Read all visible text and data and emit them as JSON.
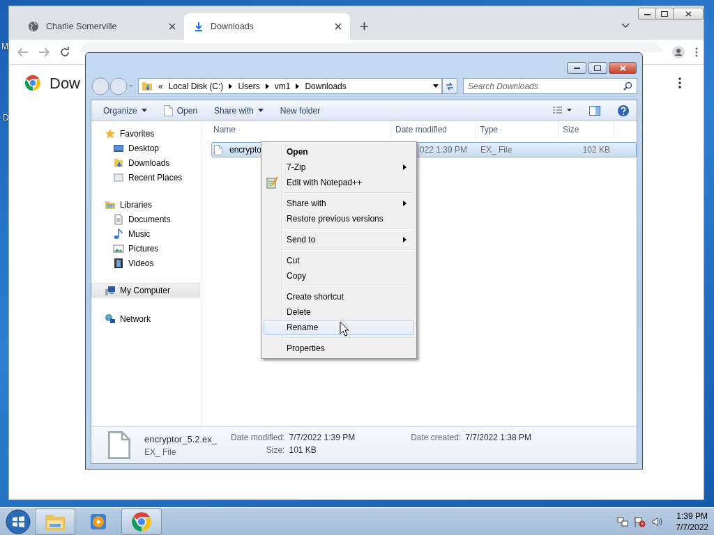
{
  "desktop": {
    "icon_labels": [
      "M",
      "D"
    ]
  },
  "browser": {
    "tabs": [
      {
        "title": "Charlie Somerville",
        "selected": false
      },
      {
        "title": "Downloads",
        "selected": true
      }
    ],
    "new_tab": "+",
    "page_title": "Dow"
  },
  "explorer": {
    "breadcrumb_overflow": "«",
    "breadcrumb": [
      "Local Disk (C:)",
      "Users",
      "vm1",
      "Downloads"
    ],
    "search": {
      "placeholder": "Search Downloads"
    },
    "commands": [
      {
        "label": "Organize",
        "kind": "menu"
      },
      {
        "label": "Open",
        "kind": "icon"
      },
      {
        "label": "Share with",
        "kind": "menu"
      },
      {
        "label": "New folder",
        "kind": "plain"
      }
    ],
    "nav": [
      {
        "label": "Favorites",
        "kind": "star",
        "selected": false,
        "children": [
          {
            "label": "Desktop",
            "kind": "desktop",
            "selected": false
          },
          {
            "label": "Downloads",
            "kind": "downloads",
            "selected": false
          },
          {
            "label": "Recent Places",
            "kind": "recent",
            "selected": false
          }
        ]
      },
      {
        "label": "Libraries",
        "kind": "libraries",
        "selected": false,
        "children": [
          {
            "label": "Documents",
            "kind": "documents",
            "selected": false
          },
          {
            "label": "Music",
            "kind": "music",
            "selected": false
          },
          {
            "label": "Pictures",
            "kind": "pictures",
            "selected": false
          },
          {
            "label": "Videos",
            "kind": "videos",
            "selected": false
          }
        ]
      },
      {
        "label": "My Computer",
        "kind": "computer",
        "selected": true
      },
      {
        "label": "Network",
        "kind": "network",
        "selected": false
      }
    ],
    "columns": [
      "Name",
      "Date modified",
      "Type",
      "Size"
    ],
    "rows": [
      {
        "name": "encrypto",
        "date_modified": "022 1:39 PM",
        "type": "EX_ File",
        "size": "102 KB",
        "selected": true
      }
    ],
    "details": {
      "name": "encryptor_5.2.ex_",
      "type": "EX_ File",
      "groups": [
        [
          {
            "label": "Date modified:",
            "value": "7/7/2022 1:39 PM"
          },
          {
            "label": "Size:",
            "value": "101 KB"
          }
        ],
        [
          {
            "label": "Date created:",
            "value": "7/7/2022 1:38 PM"
          }
        ]
      ]
    }
  },
  "context_menu": [
    [
      {
        "label": "Open",
        "default": true,
        "submenu": false,
        "has_icon": false,
        "selected": false
      },
      {
        "label": "7-Zip",
        "default": false,
        "submenu": true,
        "has_icon": false,
        "selected": false
      },
      {
        "label": "Edit with Notepad++",
        "default": false,
        "submenu": false,
        "has_icon": true,
        "selected": false
      }
    ],
    [
      {
        "label": "Share with",
        "default": false,
        "submenu": true,
        "has_icon": false,
        "selected": false
      },
      {
        "label": "Restore previous versions",
        "default": false,
        "submenu": false,
        "has_icon": false,
        "selected": false
      }
    ],
    [
      {
        "label": "Send to",
        "default": false,
        "submenu": true,
        "has_icon": false,
        "selected": false
      }
    ],
    [
      {
        "label": "Cut",
        "default": false,
        "submenu": false,
        "has_icon": false,
        "selected": false
      },
      {
        "label": "Copy",
        "default": false,
        "submenu": false,
        "has_icon": false,
        "selected": false
      }
    ],
    [
      {
        "label": "Create shortcut",
        "default": false,
        "submenu": false,
        "has_icon": false,
        "selected": false
      },
      {
        "label": "Delete",
        "default": false,
        "submenu": false,
        "has_icon": false,
        "selected": false
      },
      {
        "label": "Rename",
        "default": false,
        "submenu": false,
        "has_icon": false,
        "selected": true
      }
    ],
    [
      {
        "label": "Properties",
        "default": false,
        "submenu": false,
        "has_icon": false,
        "selected": false
      }
    ]
  ],
  "taskbar": {
    "apps": [
      {
        "kind": "explorer",
        "selected": true
      },
      {
        "kind": "media",
        "selected": false
      },
      {
        "kind": "chrome",
        "selected": true
      }
    ],
    "time": "1:39 PM",
    "date": "7/7/2022"
  }
}
